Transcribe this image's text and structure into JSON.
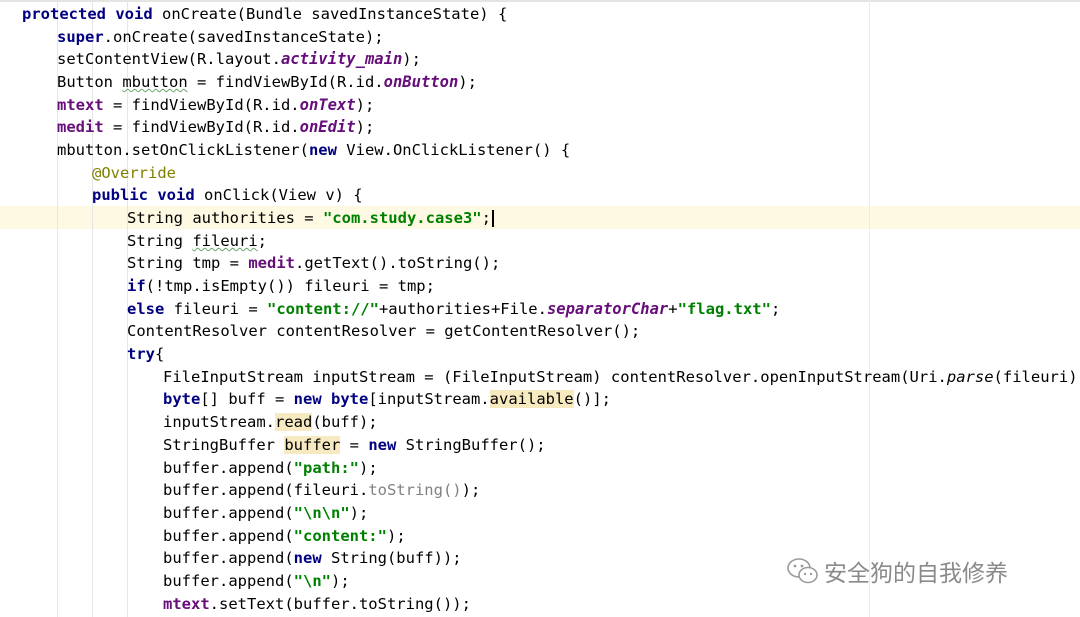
{
  "code": {
    "line1": {
      "kw1": "protected",
      "kw2": "void",
      "rest": " onCreate(Bundle savedInstanceState) {"
    },
    "line2": {
      "kw": "super",
      "rest": ".onCreate(savedInstanceState);"
    },
    "line3": {
      "a": "setContentView(R.layout.",
      "it": "activity_main",
      "b": ");"
    },
    "line4": {
      "a": "Button ",
      "var": "mbutton",
      "b": " = findViewById(R.id.",
      "it": "onButton",
      "c": ");"
    },
    "line5": {
      "fld": "mtext",
      "a": " = findViewById(R.id.",
      "it": "onText",
      "b": ");"
    },
    "line6": {
      "fld": "medit",
      "a": " = findViewById(R.id.",
      "it": "onEdit",
      "b": ");"
    },
    "line7": {
      "a": "mbutton.setOnClickListener(",
      "kw": "new",
      "b": " View.OnClickListener() {"
    },
    "line8": {
      "ann": "@Override"
    },
    "line9": {
      "kw1": "public",
      "kw2": "void",
      "rest": " onClick(View v) {"
    },
    "line10": {
      "a": "String authorities = ",
      "str": "\"com.study.case3\"",
      "b": ";"
    },
    "line11": {
      "a": "String ",
      "var": "fileuri",
      "b": ";"
    },
    "line12": {
      "a": "String tmp = ",
      "fld": "medit",
      "b": ".getText().toString();"
    },
    "line13": {
      "kw": "if",
      "a": "(!tmp.isEmpty()) fileuri = tmp;"
    },
    "line14": {
      "kw": "else",
      "a": " fileuri = ",
      "str1": "\"content://\"",
      "b": "+authorities+File.",
      "it": "separatorChar",
      "c": "+",
      "str2": "\"flag.txt\"",
      "d": ";"
    },
    "line15": {
      "a": "ContentResolver contentResolver = getContentResolver();"
    },
    "line16": {
      "kw": "try",
      "a": "{"
    },
    "line17": {
      "a": "FileInputStream inputStream = (FileInputStream) contentResolver.openInputStream(Uri.",
      "sm": "parse",
      "b": "(fileuri));"
    },
    "line18": {
      "kw1": "byte",
      "a": "[] buff = ",
      "kw2": "new",
      "b": " ",
      "kw3": "byte",
      "c": "[inputStream.",
      "hl": "available",
      "d": "()];"
    },
    "line19": {
      "a": "inputStream.",
      "hl": "read",
      "b": "(buff);"
    },
    "line20": {
      "a": "StringBuffer ",
      "hl": "buffer",
      "b": " = ",
      "kw": "new",
      "c": " StringBuffer();"
    },
    "line21": {
      "a": "buffer.append(",
      "str": "\"path:\"",
      "b": ");"
    },
    "line22": {
      "a": "buffer.append(fileuri.",
      "gray": "toString()",
      "b": ");"
    },
    "line23": {
      "a": "buffer.append(",
      "str": "\"\\n\\n\"",
      "b": ");"
    },
    "line24": {
      "a": "buffer.append(",
      "str": "\"content:\"",
      "b": ");"
    },
    "line25": {
      "a": "buffer.append(",
      "kw": "new",
      "b": " String(buff));"
    },
    "line26": {
      "a": "buffer.append(",
      "str": "\"\\n\"",
      "b": ");"
    },
    "line27": {
      "fld": "mtext",
      "a": ".setText(buffer.toString());"
    }
  },
  "watermark": {
    "text": "安全狗的自我修养",
    "icon": "wechat-icon"
  }
}
